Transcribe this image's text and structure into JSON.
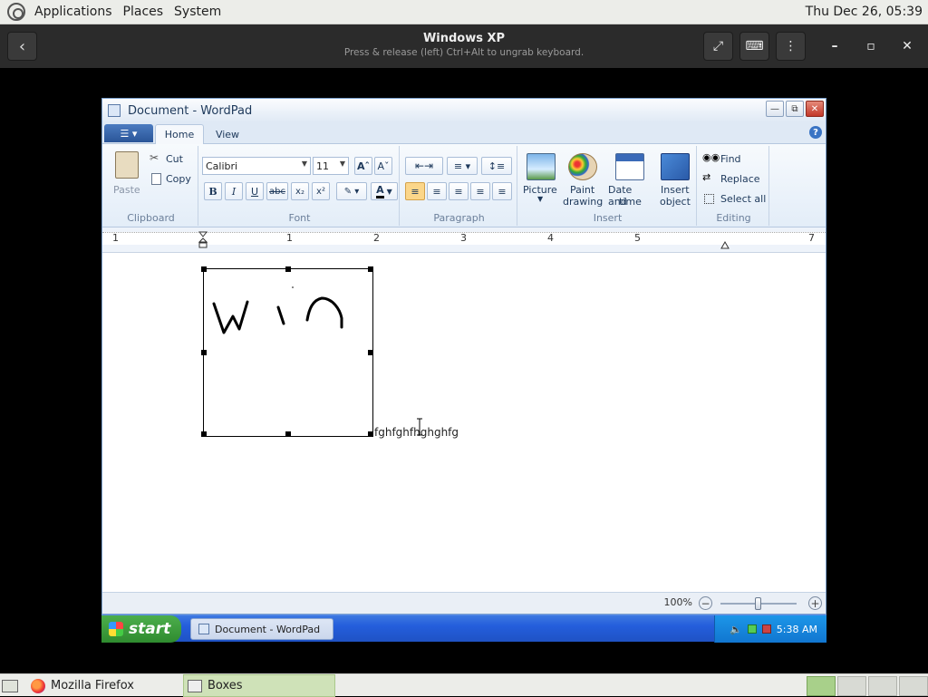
{
  "top_panel": {
    "menus": [
      "Applications",
      "Places",
      "System"
    ],
    "clock": "Thu Dec 26, 05:39"
  },
  "boxes_header": {
    "title": "Windows XP",
    "subtitle": "Press & release (left) Ctrl+Alt to ungrab keyboard."
  },
  "wordpad": {
    "window_title": "Document - WordPad",
    "tabs": [
      "Home",
      "View"
    ],
    "clipboard": {
      "paste": "Paste",
      "cut": "Cut",
      "copy": "Copy",
      "group": "Clipboard"
    },
    "font": {
      "name": "Calibri",
      "size": "11",
      "group": "Font",
      "bold": "B",
      "italic": "I",
      "underline": "U",
      "strike": "abc"
    },
    "paragraph": {
      "group": "Paragraph"
    },
    "insert": {
      "picture": "Picture",
      "paint_1": "Paint",
      "paint_2": "drawing",
      "date_1": "Date and",
      "date_2": "time",
      "obj_1": "Insert",
      "obj_2": "object",
      "group": "Insert"
    },
    "editing": {
      "find": "Find",
      "replace": "Replace",
      "select_all": "Select all",
      "group": "Editing"
    },
    "ruler_numbers": [
      "1",
      "1",
      "2",
      "3",
      "4",
      "5",
      "7"
    ],
    "document_text": "fghfghfhghghfg",
    "zoom": "100%"
  },
  "xp_taskbar": {
    "start": "start",
    "task": "Document - WordPad",
    "time": "5:38 AM"
  },
  "bottom_panel": {
    "firefox": "Mozilla Firefox",
    "boxes": "Boxes"
  }
}
